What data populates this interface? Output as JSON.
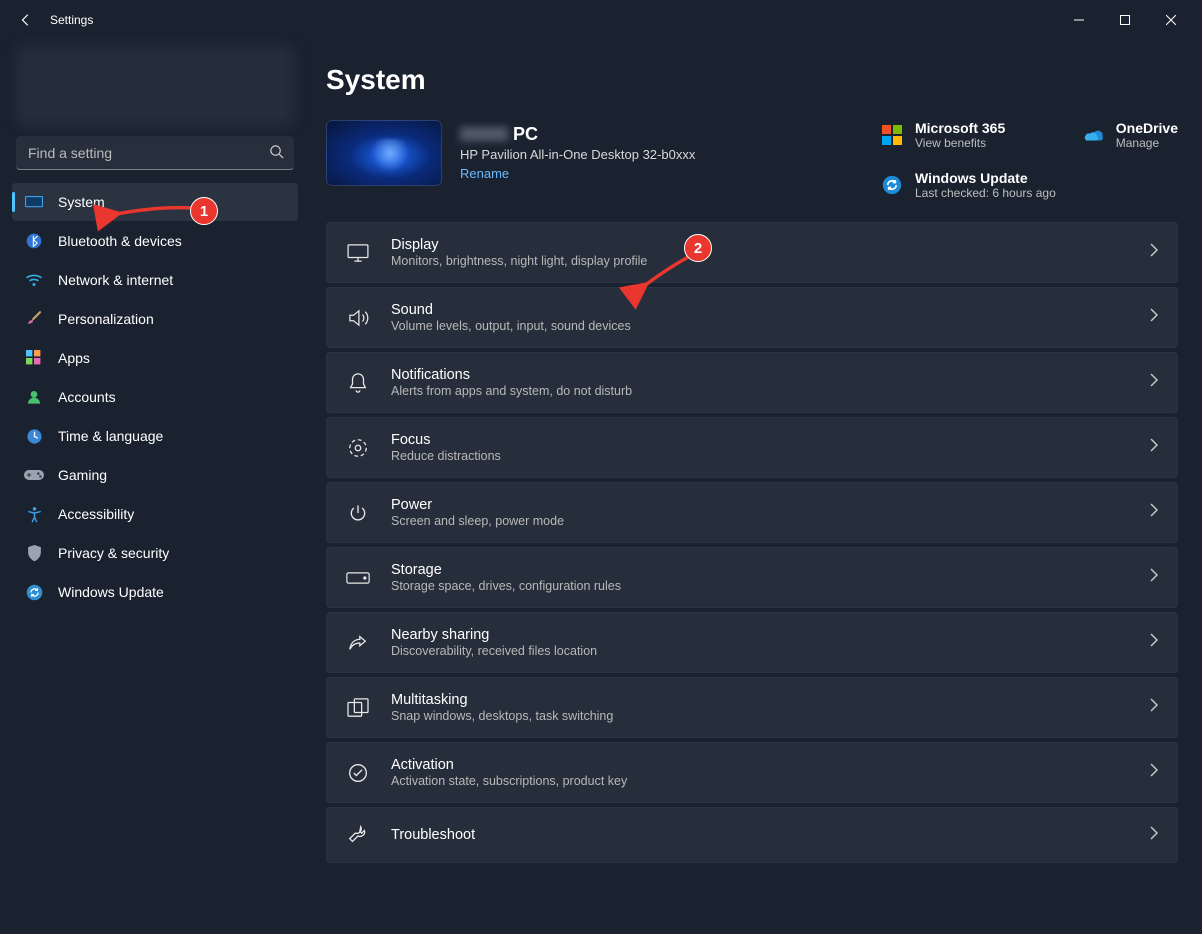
{
  "app": {
    "title": "Settings",
    "page_title": "System"
  },
  "search": {
    "placeholder": "Find a setting"
  },
  "sidebar": {
    "items": [
      {
        "label": "System",
        "icon": "monitor",
        "active": true
      },
      {
        "label": "Bluetooth & devices",
        "icon": "bluetooth"
      },
      {
        "label": "Network & internet",
        "icon": "wifi"
      },
      {
        "label": "Personalization",
        "icon": "brush"
      },
      {
        "label": "Apps",
        "icon": "apps"
      },
      {
        "label": "Accounts",
        "icon": "person"
      },
      {
        "label": "Time & language",
        "icon": "clock"
      },
      {
        "label": "Gaming",
        "icon": "gaming"
      },
      {
        "label": "Accessibility",
        "icon": "accessibility"
      },
      {
        "label": "Privacy & security",
        "icon": "shield"
      },
      {
        "label": "Windows Update",
        "icon": "update"
      }
    ]
  },
  "pc": {
    "name_suffix": "PC",
    "model": "HP Pavilion All-in-One Desktop 32-b0xxx",
    "rename": "Rename"
  },
  "top_links": [
    {
      "title": "Microsoft 365",
      "sub": "View benefits",
      "icon": "ms365"
    },
    {
      "title": "OneDrive",
      "sub": "Manage",
      "icon": "onedrive"
    },
    {
      "title": "Windows Update",
      "sub": "Last checked: 6 hours ago",
      "icon": "update-blue"
    }
  ],
  "settings": [
    {
      "title": "Display",
      "sub": "Monitors, brightness, night light, display profile",
      "icon": "display"
    },
    {
      "title": "Sound",
      "sub": "Volume levels, output, input, sound devices",
      "icon": "sound"
    },
    {
      "title": "Notifications",
      "sub": "Alerts from apps and system, do not disturb",
      "icon": "bell"
    },
    {
      "title": "Focus",
      "sub": "Reduce distractions",
      "icon": "focus"
    },
    {
      "title": "Power",
      "sub": "Screen and sleep, power mode",
      "icon": "power"
    },
    {
      "title": "Storage",
      "sub": "Storage space, drives, configuration rules",
      "icon": "storage"
    },
    {
      "title": "Nearby sharing",
      "sub": "Discoverability, received files location",
      "icon": "share"
    },
    {
      "title": "Multitasking",
      "sub": "Snap windows, desktops, task switching",
      "icon": "multitask"
    },
    {
      "title": "Activation",
      "sub": "Activation state, subscriptions, product key",
      "icon": "check"
    },
    {
      "title": "Troubleshoot",
      "sub": "",
      "icon": "wrench"
    }
  ],
  "annotations": {
    "step1": "1",
    "step2": "2"
  }
}
